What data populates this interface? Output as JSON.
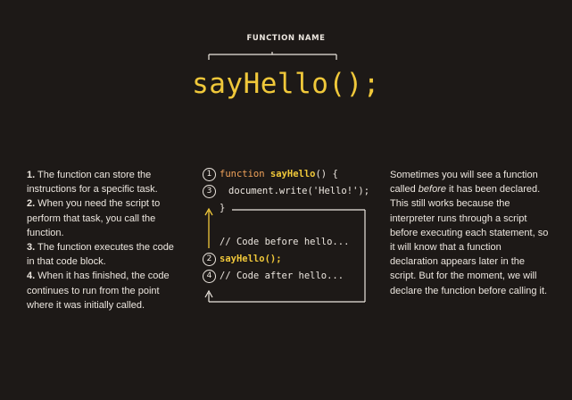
{
  "header": {
    "label": "FUNCTION NAME",
    "call": "sayHello();"
  },
  "steps": [
    {
      "num": "1.",
      "text": "The function can store the instructions for a specific task."
    },
    {
      "num": "2.",
      "text": "When you need the script to perform that task, you call the function."
    },
    {
      "num": "3.",
      "text": "The function executes the code in that code block."
    },
    {
      "num": "4.",
      "text": "When it has finished, the code continues to run from the point where it was initially called."
    }
  ],
  "code": {
    "line1_kw": "function",
    "line1_name": "sayHello",
    "line1_rest": "() {",
    "line2": "document.write('Hello!');",
    "line3": "}",
    "line4": "// Code before hello...",
    "line5": "sayHello();",
    "line6": "// Code after hello...",
    "markers": [
      "1",
      "3",
      "2",
      "4"
    ]
  },
  "side_note": {
    "before": "Sometimes you will see a function called ",
    "emph": "before",
    "after": " it has been declared. This still works because the interpreter runs through a script before executing each statement, so it will know that a function declaration appears later in the script. But for the moment, we will declare the function before calling it."
  },
  "colors": {
    "background": "#1d1917",
    "text": "#ece6df",
    "highlight": "#f0c83a",
    "keyword": "#f0a25a"
  }
}
